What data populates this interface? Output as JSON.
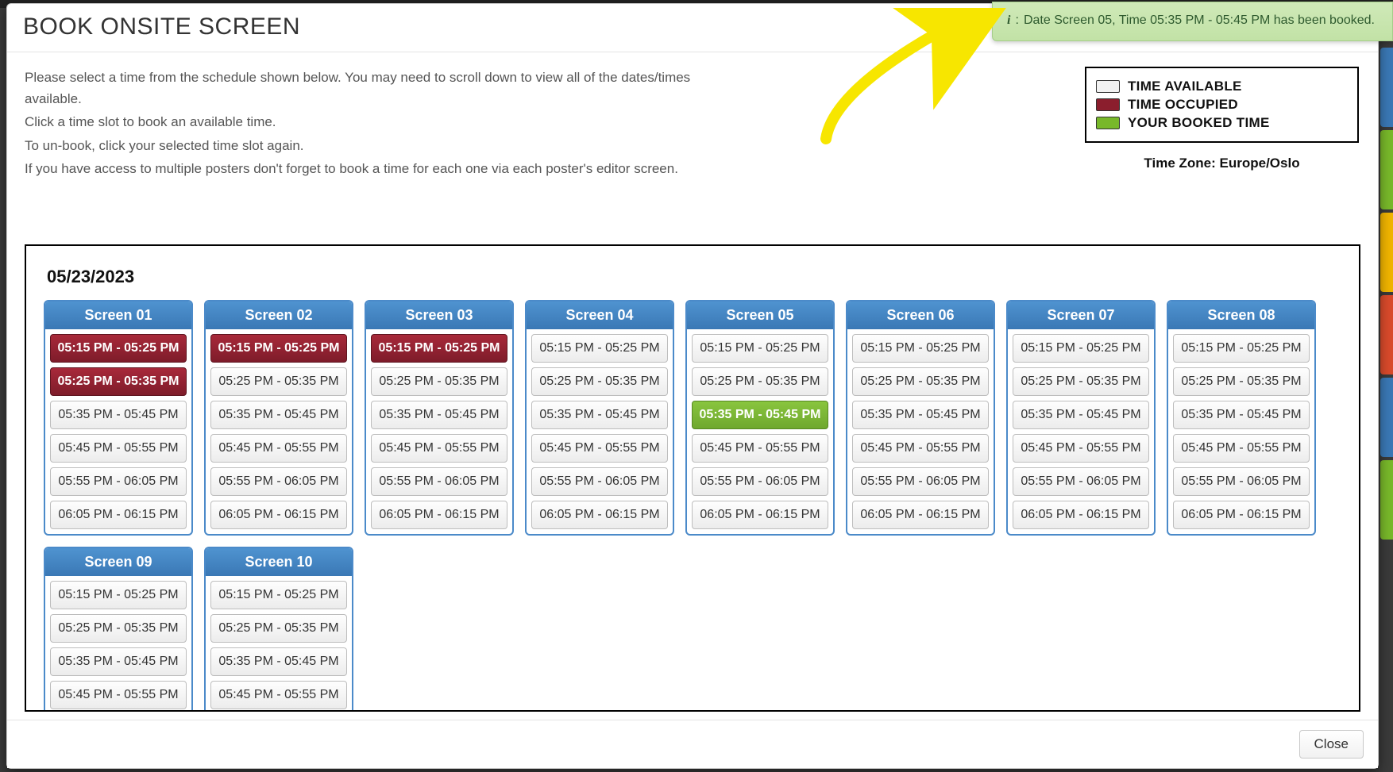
{
  "title": "BOOK ONSITE SCREEN",
  "instructions": [
    "Please select a time from the schedule shown below. You may need to scroll down to view all of the dates/times available.",
    "Click a time slot to book an available time.",
    "To un-book, click your selected time slot again.",
    "If you have access to multiple posters don't forget to book a time for each one via each poster's editor screen."
  ],
  "legend": {
    "available": "TIME AVAILABLE",
    "occupied": "TIME OCCUPIED",
    "booked": "YOUR BOOKED TIME"
  },
  "timezone": "Time Zone: Europe/Oslo",
  "toast": {
    "text": "Date Screen 05, Time 05:35 PM - 05:45 PM has been booked."
  },
  "close_label": "Close",
  "side_tab_colors": [
    "#3a78b5",
    "#78b82a",
    "#f0b400",
    "#d94a2b",
    "#3a78b5",
    "#78b82a"
  ],
  "schedule": {
    "date": "05/23/2023",
    "slot_times": [
      "05:15 PM - 05:25 PM",
      "05:25 PM - 05:35 PM",
      "05:35 PM - 05:45 PM",
      "05:45 PM - 05:55 PM",
      "05:55 PM - 06:05 PM",
      "06:05 PM - 06:15 PM"
    ],
    "extra_slot_times": [
      "05:15 PM - 05:25 PM",
      "05:25 PM - 05:35 PM",
      "05:35 PM - 05:45 PM",
      "05:45 PM - 05:55 PM"
    ],
    "screens": [
      {
        "name": "Screen 01",
        "kind": "full",
        "states": [
          "occupied",
          "occupied",
          "available",
          "available",
          "available",
          "available"
        ]
      },
      {
        "name": "Screen 02",
        "kind": "full",
        "states": [
          "occupied",
          "available",
          "available",
          "available",
          "available",
          "available"
        ]
      },
      {
        "name": "Screen 03",
        "kind": "full",
        "states": [
          "occupied",
          "available",
          "available",
          "available",
          "available",
          "available"
        ]
      },
      {
        "name": "Screen 04",
        "kind": "full",
        "states": [
          "available",
          "available",
          "available",
          "available",
          "available",
          "available"
        ]
      },
      {
        "name": "Screen 05",
        "kind": "full",
        "states": [
          "available",
          "available",
          "booked",
          "available",
          "available",
          "available"
        ]
      },
      {
        "name": "Screen 06",
        "kind": "full",
        "states": [
          "available",
          "available",
          "available",
          "available",
          "available",
          "available"
        ]
      },
      {
        "name": "Screen 07",
        "kind": "full",
        "states": [
          "available",
          "available",
          "available",
          "available",
          "available",
          "available"
        ]
      },
      {
        "name": "Screen 08",
        "kind": "full",
        "states": [
          "available",
          "available",
          "available",
          "available",
          "available",
          "available"
        ]
      },
      {
        "name": "Screen 09",
        "kind": "extra",
        "states": [
          "available",
          "available",
          "available",
          "available"
        ]
      },
      {
        "name": "Screen 10",
        "kind": "extra",
        "states": [
          "available",
          "available",
          "available",
          "available"
        ]
      }
    ]
  }
}
